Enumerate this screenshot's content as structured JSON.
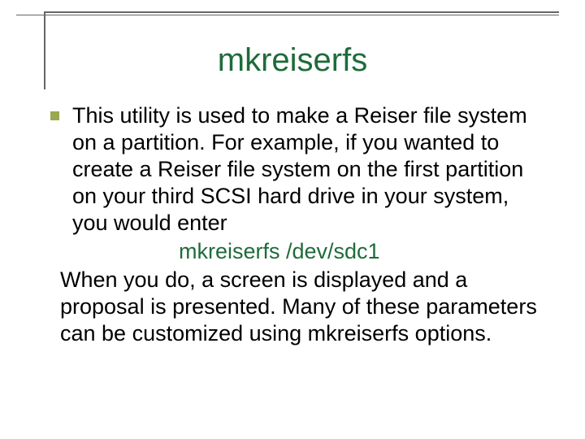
{
  "title": "mkreiserfs",
  "bullet": {
    "intro": "This utility is used to make a Reiser file system on a partition. For example, if you wanted to create a Reiser file system on the first partition on your third SCSI hard drive in your system, you would enter",
    "command": "mkreiserfs  /dev/sdc1",
    "followup": "When you do, a screen is displayed and a proposal is presented. Many of these parameters can be customized using mkreiserfs options."
  },
  "colors": {
    "accent": "#1e6b3a",
    "bullet": "#9aa84f",
    "rule": "#666666"
  }
}
